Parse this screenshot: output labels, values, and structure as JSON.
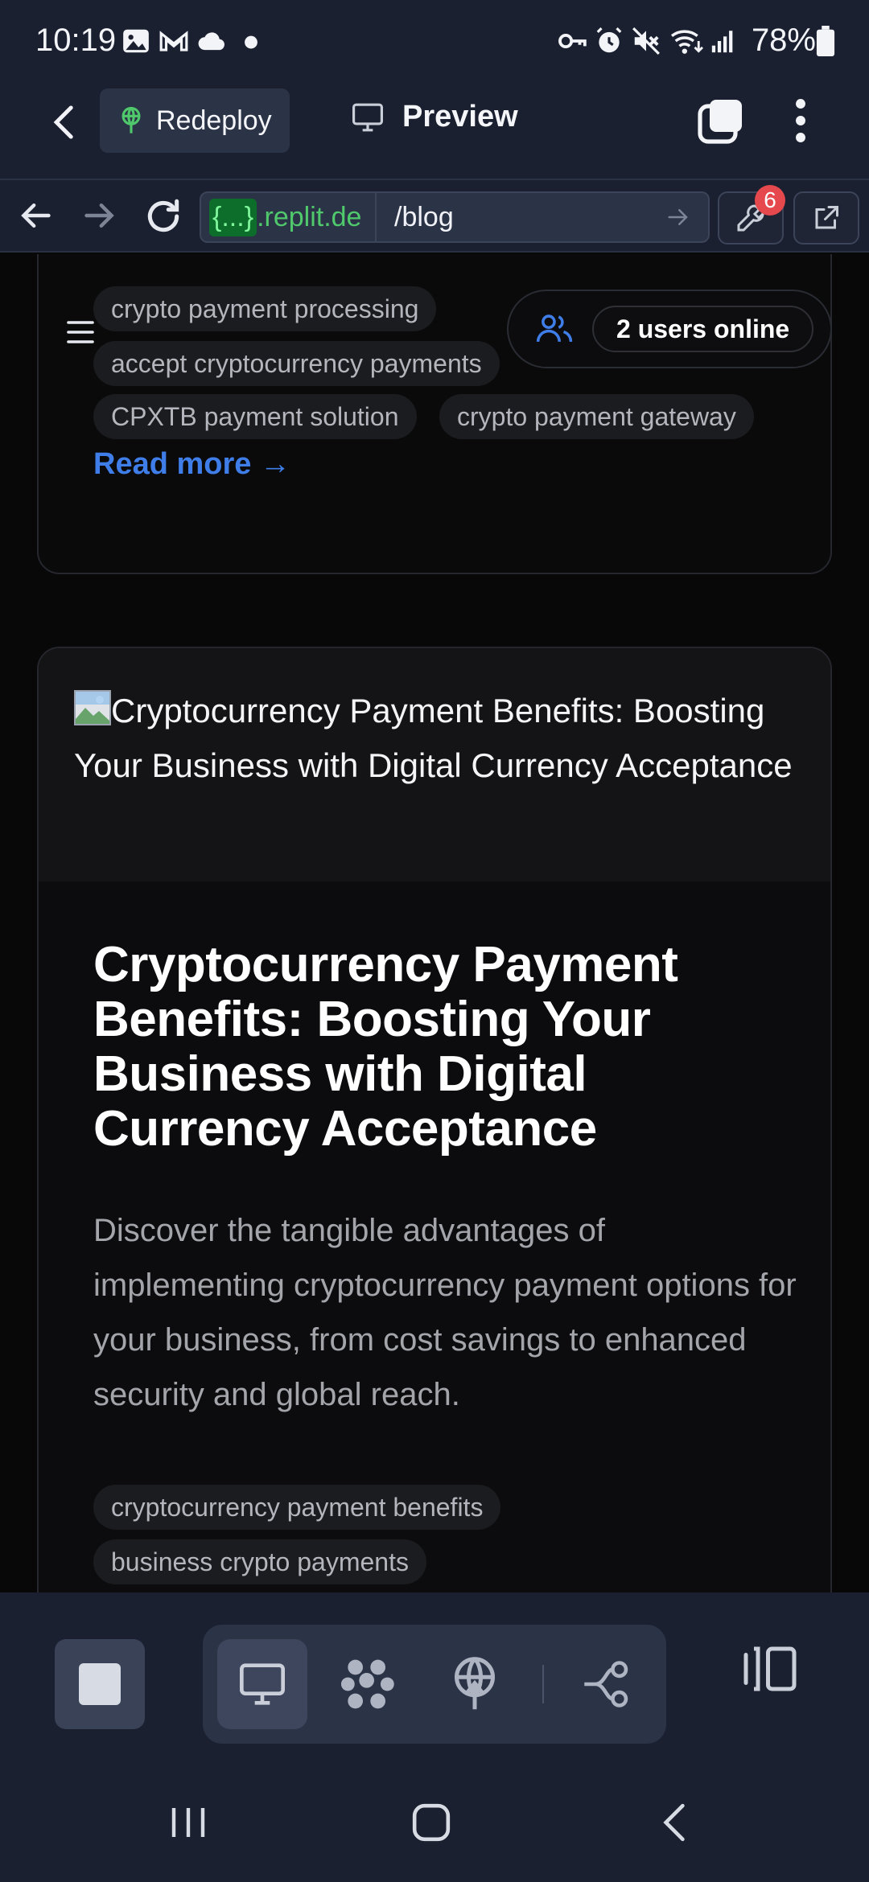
{
  "status_bar": {
    "time": "10:19",
    "battery": "78%",
    "left_icons": [
      "gallery-icon",
      "gmail-icon",
      "cloud-icon",
      "dot-icon"
    ],
    "right_icons": [
      "key-icon",
      "alarm-icon",
      "mute-icon",
      "wifi-icon",
      "signal-icon",
      "battery-icon"
    ]
  },
  "header": {
    "redeploy_label": "Redeploy",
    "preview_label": "Preview"
  },
  "url_bar": {
    "domain_pill": "{...}",
    "domain_rest": ".replit.de",
    "path": "/blog",
    "devtools_badge": "6"
  },
  "page": {
    "users_online": "2 users online",
    "card1": {
      "tags": [
        "crypto payment processing",
        "accept cryptocurrency payments",
        "CPXTB payment solution",
        "crypto payment gateway"
      ],
      "read_more": "Read more →"
    },
    "card2": {
      "image_alt": "Cryptocurrency Payment Benefits: Boosting Your Business with Digital Currency Acceptance",
      "title": "Cryptocurrency Payment Benefits: Boosting Your Business with Digital Currency Acceptance",
      "description": "Discover the tangible advantages of implementing cryptocurrency payment options for your business, from cost savings to enhanced security and global reach.",
      "tags": [
        "cryptocurrency payment benefits",
        "business crypto payments"
      ]
    }
  },
  "colors": {
    "accent_blue": "#3f7ee8",
    "replit_green": "#4fc96b",
    "badge_red": "#e5484d",
    "chrome_bg": "#1b2030"
  }
}
